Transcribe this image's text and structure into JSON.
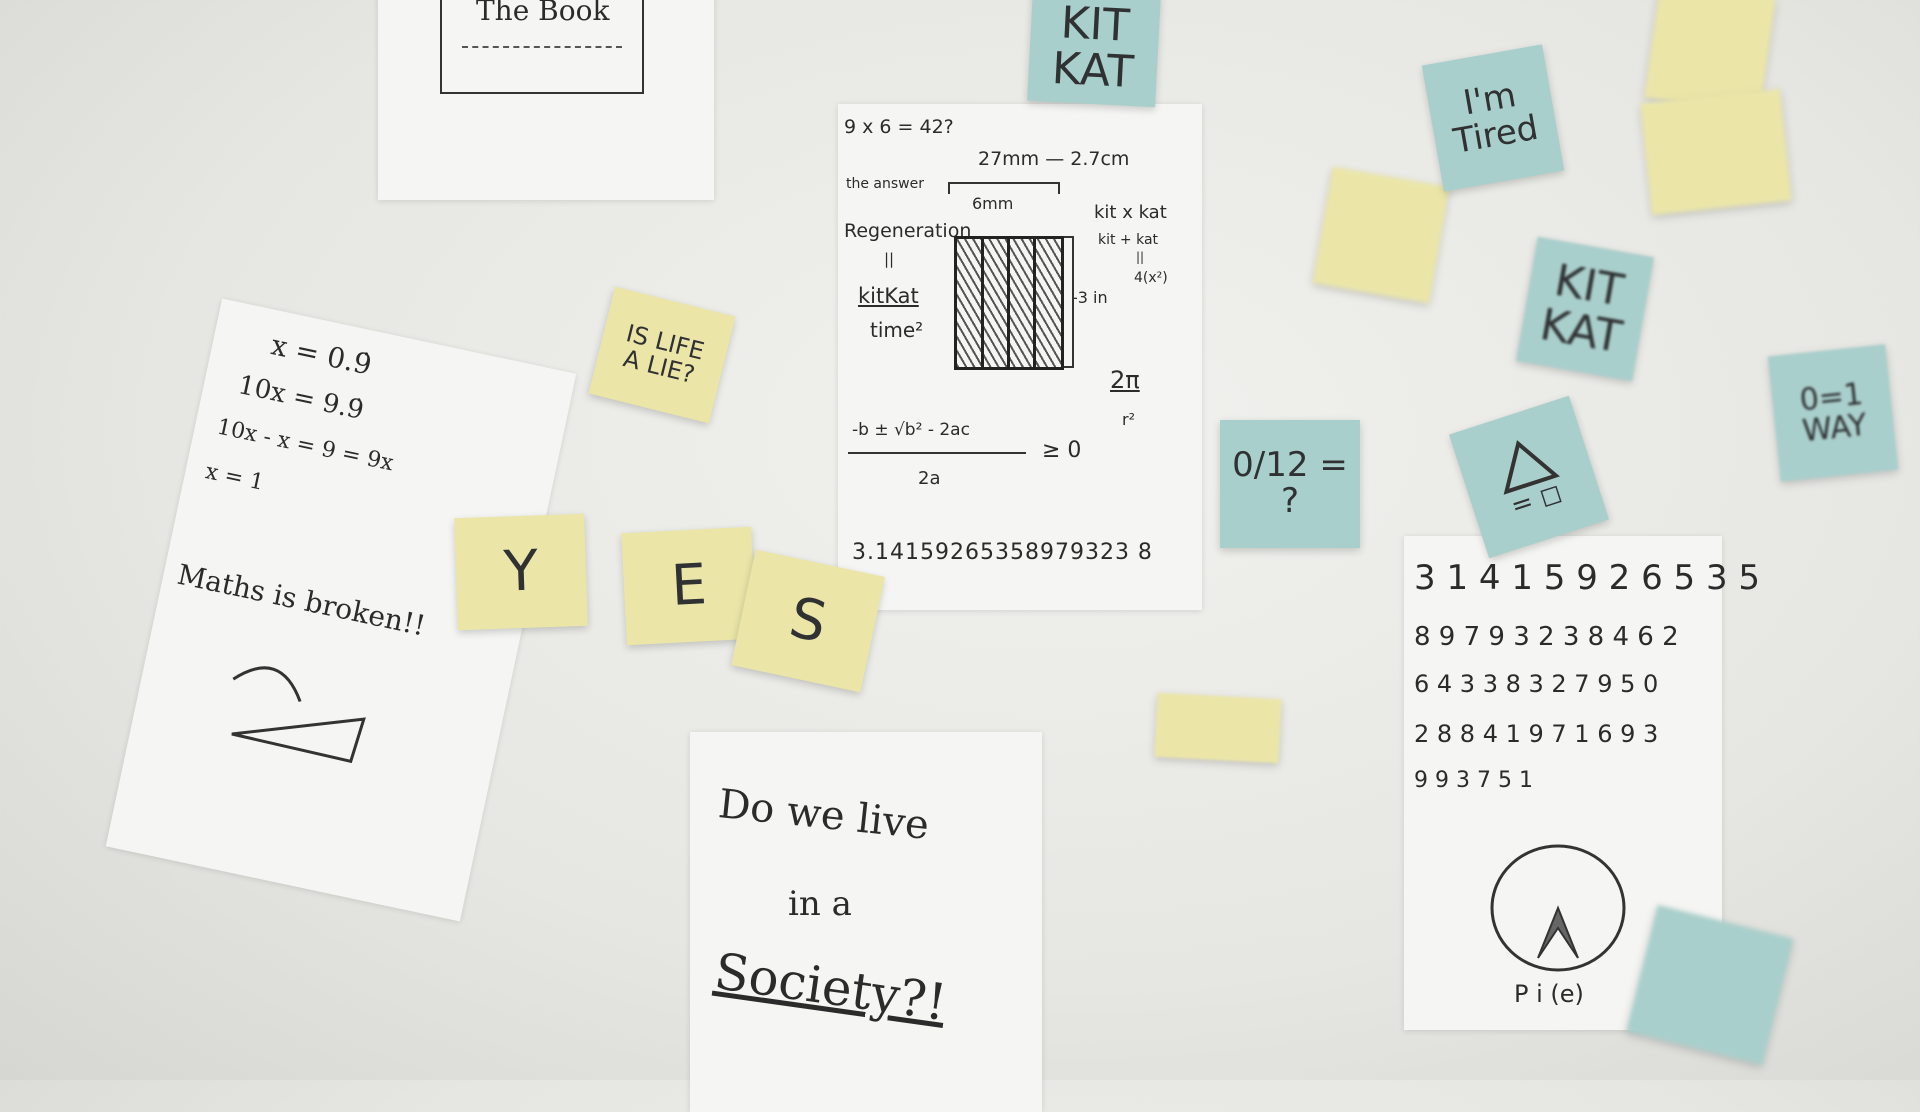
{
  "top_paper": {
    "frame_text": "The Book"
  },
  "center_paper": {
    "lines": {
      "eq1": "9 x 6 = 42?",
      "answer": "the answer",
      "dim_top": "27mm — 2.7cm",
      "dim_mid": "6mm",
      "regen": "Regeneration",
      "eq_sign": "||",
      "kitkat": "kitKat",
      "time": "time²",
      "kxk": "kit x kat",
      "kpk": "kit + kat",
      "eq2": "||",
      "four": "4(x²)",
      "three_in": "-3 in",
      "two_pi": "2π",
      "r2": "r²",
      "quad_top": "-b ± √b² - 2ac",
      "quad_bot": "2a",
      "geq": "≥ 0",
      "pi": "3.14159265358979323 8"
    }
  },
  "left_paper": {
    "lines": [
      "x = 0.9̇",
      "10x = 9.9̇",
      "10x - x = 9 = 9x",
      "x = 1",
      "Maths is broken!!"
    ]
  },
  "bottom_paper": {
    "lines": [
      "Do we live",
      "in a",
      "Society?!"
    ]
  },
  "right_paper": {
    "rows": [
      "3 1 4 1 5 9 2 6 5 3 5",
      "8 9 7 9 3 2 3 8 4 6 2",
      "6 4 3 3 8 3 2 7 9 5 0",
      "2 8 8 4 1 9 7 1 6 9 3",
      "9 9 3 7 5 1"
    ],
    "caption": "P i (e)"
  },
  "notes": {
    "is_life": "IS LIFE\nA LIE?",
    "y": "Y",
    "e": "E",
    "s": "S",
    "kitkat_top": "KIT\nKAT",
    "im_tired": "I'm\nTired",
    "kitkat_right": "KIT\nKAT",
    "zero_twelve": "0/12 = ?",
    "zero_one": "0=1\nWAY",
    "delta": "= ◻"
  },
  "colors": {
    "sticky_yellow": "#ebe6a8",
    "sticky_blue": "#a9cfcc",
    "paper": "#f5f5f3",
    "wall": "#e9e9e6"
  }
}
